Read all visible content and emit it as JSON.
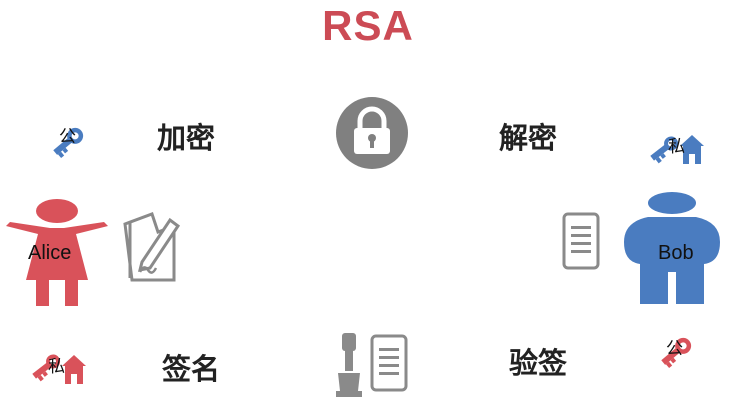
{
  "title": "RSA",
  "labels": {
    "encrypt": "加密",
    "decrypt": "解密",
    "sign": "签名",
    "verify": "验签"
  },
  "people": {
    "alice": {
      "name": "Alice",
      "color": "#d9525a"
    },
    "bob": {
      "name": "Bob",
      "color": "#4a7cc0"
    }
  },
  "keys": {
    "alice_public": "公",
    "bob_private": "私",
    "alice_private": "私",
    "bob_public": "公"
  },
  "colors": {
    "red": "#d9525a",
    "blue": "#4a7cc0",
    "gray": "#808080",
    "title": "#cc4b55"
  },
  "icons": [
    "lock-icon",
    "key-icon",
    "house-key-icon",
    "pen-paper-icon",
    "document-icon",
    "stamp-icon"
  ]
}
